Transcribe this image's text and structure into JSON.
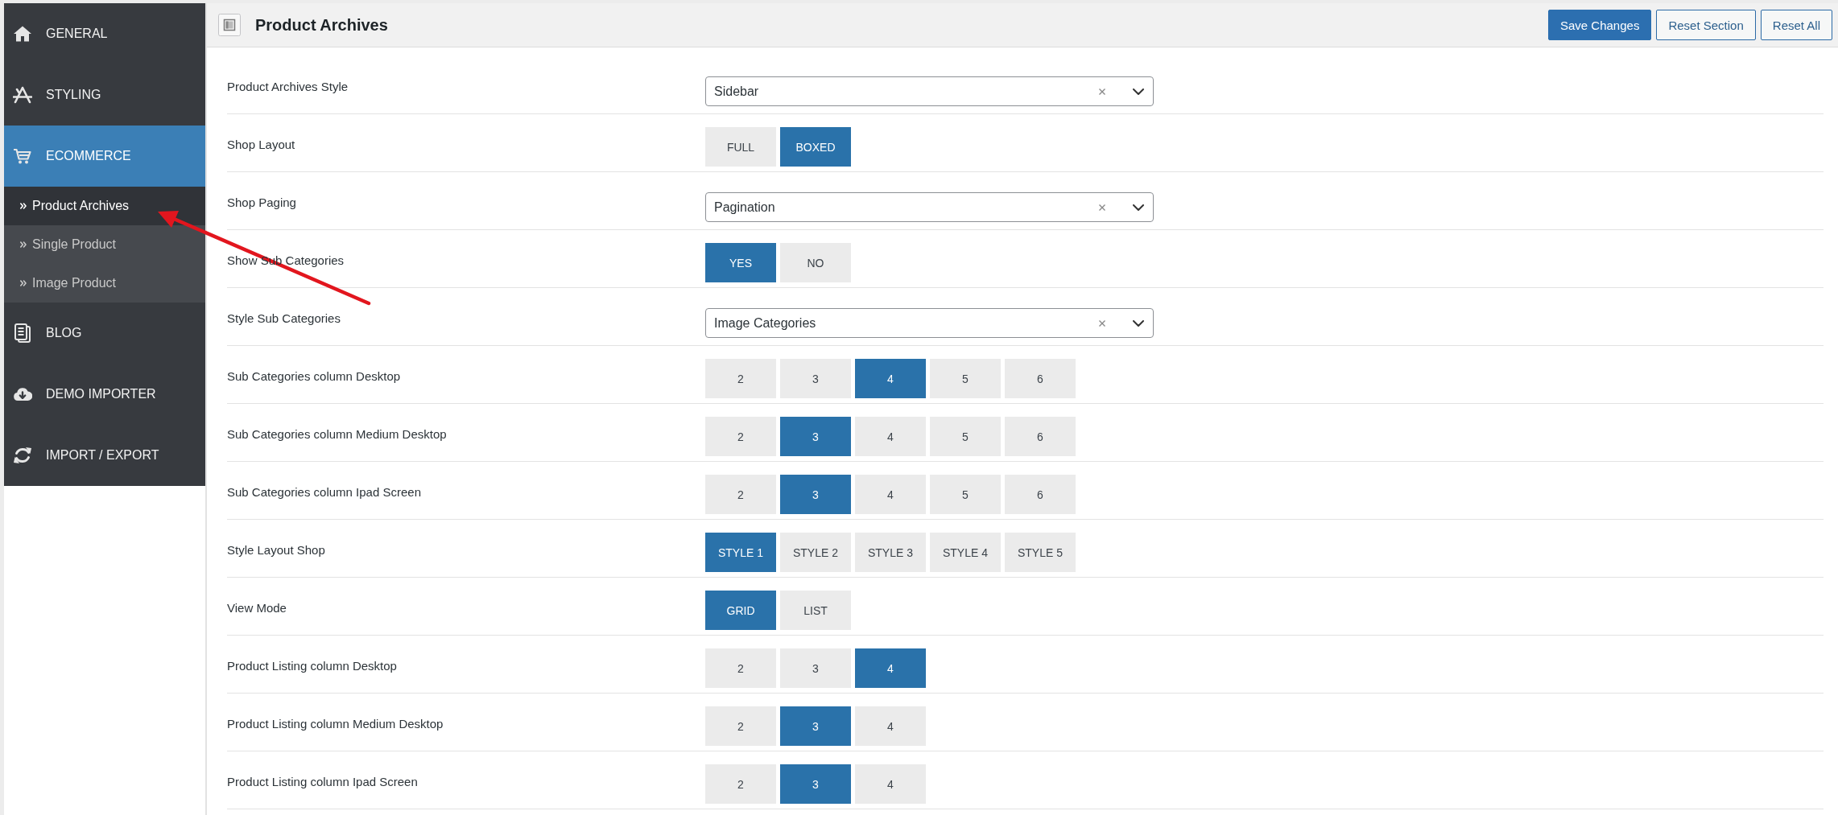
{
  "sidebar": {
    "items": [
      {
        "label": "GENERAL",
        "selected": false
      },
      {
        "label": "STYLING",
        "selected": false
      },
      {
        "label": "ECOMMERCE",
        "selected": true,
        "children": [
          {
            "label": "Product Archives",
            "selected": true
          },
          {
            "label": "Single Product",
            "selected": false
          },
          {
            "label": "Image Product",
            "selected": false
          }
        ]
      },
      {
        "label": "BLOG",
        "selected": false
      },
      {
        "label": "DEMO IMPORTER",
        "selected": false
      },
      {
        "label": "IMPORT / EXPORT",
        "selected": false
      }
    ]
  },
  "header": {
    "title": "Product Archives",
    "buttons": [
      {
        "label": "Save Changes",
        "kind": "primary"
      },
      {
        "label": "Reset Section",
        "kind": "secondary"
      },
      {
        "label": "Reset All",
        "kind": "secondary"
      }
    ]
  },
  "settings": [
    {
      "label": "Product Archives Style",
      "kind": "select",
      "value": "Sidebar"
    },
    {
      "label": "Shop Layout",
      "kind": "choice",
      "options": [
        {
          "label": "FULL",
          "selected": false
        },
        {
          "label": "BOXED",
          "selected": true
        }
      ]
    },
    {
      "label": "Shop Paging",
      "kind": "select",
      "value": "Pagination"
    },
    {
      "label": "Show Sub Categories",
      "kind": "choice",
      "options": [
        {
          "label": "YES",
          "selected": true
        },
        {
          "label": "NO",
          "selected": false
        }
      ]
    },
    {
      "label": "Style Sub Categories",
      "kind": "select",
      "value": "Image Categories"
    },
    {
      "label": "Sub Categories column Desktop",
      "kind": "choice",
      "options": [
        {
          "label": "2",
          "selected": false
        },
        {
          "label": "3",
          "selected": false
        },
        {
          "label": "4",
          "selected": true
        },
        {
          "label": "5",
          "selected": false
        },
        {
          "label": "6",
          "selected": false
        }
      ]
    },
    {
      "label": "Sub Categories column Medium Desktop",
      "kind": "choice",
      "options": [
        {
          "label": "2",
          "selected": false
        },
        {
          "label": "3",
          "selected": true
        },
        {
          "label": "4",
          "selected": false
        },
        {
          "label": "5",
          "selected": false
        },
        {
          "label": "6",
          "selected": false
        }
      ]
    },
    {
      "label": "Sub Categories column Ipad Screen",
      "kind": "choice",
      "options": [
        {
          "label": "2",
          "selected": false
        },
        {
          "label": "3",
          "selected": true
        },
        {
          "label": "4",
          "selected": false
        },
        {
          "label": "5",
          "selected": false
        },
        {
          "label": "6",
          "selected": false
        }
      ]
    },
    {
      "label": "Style Layout Shop",
      "kind": "choice",
      "options": [
        {
          "label": "STYLE 1",
          "selected": true
        },
        {
          "label": "STYLE 2",
          "selected": false
        },
        {
          "label": "STYLE 3",
          "selected": false
        },
        {
          "label": "STYLE 4",
          "selected": false
        },
        {
          "label": "STYLE 5",
          "selected": false
        }
      ]
    },
    {
      "label": "View Mode",
      "kind": "choice",
      "options": [
        {
          "label": "GRID",
          "selected": true
        },
        {
          "label": "LIST",
          "selected": false
        }
      ]
    },
    {
      "label": "Product Listing column Desktop",
      "kind": "choice",
      "options": [
        {
          "label": "2",
          "selected": false
        },
        {
          "label": "3",
          "selected": false
        },
        {
          "label": "4",
          "selected": true
        }
      ]
    },
    {
      "label": "Product Listing column Medium Desktop",
      "kind": "choice",
      "options": [
        {
          "label": "2",
          "selected": false
        },
        {
          "label": "3",
          "selected": true
        },
        {
          "label": "4",
          "selected": false
        }
      ]
    },
    {
      "label": "Product Listing column Ipad Screen",
      "kind": "choice",
      "options": [
        {
          "label": "2",
          "selected": false
        },
        {
          "label": "3",
          "selected": true
        },
        {
          "label": "4",
          "selected": false
        }
      ]
    }
  ]
}
